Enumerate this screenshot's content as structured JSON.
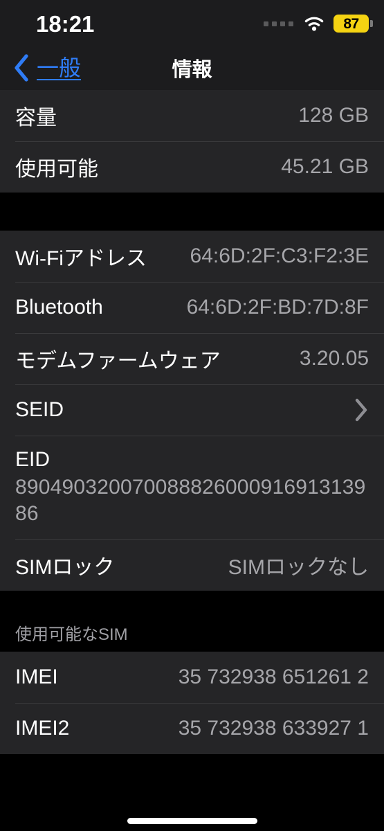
{
  "status_bar": {
    "time": "18:21",
    "cellular_icon": "cellular-dots-icon",
    "wifi_icon": "wifi-icon",
    "battery_icon": "battery-icon",
    "battery_percent": "87",
    "battery_color": "#f5d312"
  },
  "nav_bar": {
    "back_icon": "chevron-left-icon",
    "back_label": "一般",
    "title": "情報",
    "accent_color": "#2f7cf6"
  },
  "sections": [
    {
      "header": "",
      "rows": [
        {
          "label": "容量",
          "value": "128 GB",
          "type": "value"
        },
        {
          "label": "使用可能",
          "value": "45.21 GB",
          "type": "value"
        }
      ]
    },
    {
      "header": "",
      "rows": [
        {
          "label": "Wi-Fiアドレス",
          "value": "64:6D:2F:C3:F2:3E",
          "type": "value"
        },
        {
          "label": "Bluetooth",
          "value": "64:6D:2F:BD:7D:8F",
          "type": "value"
        },
        {
          "label": "モデムファームウェア",
          "value": "3.20.05",
          "type": "value"
        },
        {
          "label": "SEID",
          "value": "",
          "type": "disclosure",
          "icon": "chevron-right-icon"
        },
        {
          "label": "EID",
          "value": "89049032007008882600091691313986",
          "type": "stacked"
        },
        {
          "label": "SIMロック",
          "value": "SIMロックなし",
          "type": "value"
        }
      ]
    },
    {
      "header": "使用可能なSIM",
      "rows": [
        {
          "label": "IMEI",
          "value": "35 732938 651261 2",
          "type": "value"
        },
        {
          "label": "IMEI2",
          "value": "35 732938 633927 1",
          "type": "value"
        }
      ]
    }
  ],
  "home_indicator": "home-indicator"
}
